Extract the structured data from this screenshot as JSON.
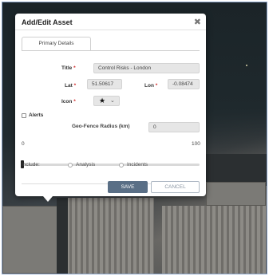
{
  "dialog": {
    "title": "Add/Edit Asset",
    "close_glyph": "✖",
    "tabs": [
      {
        "label": "Primary Details",
        "active": true
      }
    ],
    "form": {
      "title_label": "Title",
      "title_value": "Control Risks - London",
      "lat_label": "Lat",
      "lat_value": "51.50617",
      "lon_label": "Lon",
      "lon_value": "-0.08474",
      "icon_label": "Icon",
      "icon_value": "star-icon",
      "required_mark": "*",
      "alerts_label": "Alerts",
      "alerts_checked": false,
      "geofence_label": "Geo-Fence Radius (km)",
      "geofence_value": "0",
      "slider_min": "0",
      "slider_max": "100",
      "slider_value": 0,
      "include_label": "Include:",
      "include_options": [
        {
          "label": "Analysis",
          "selected": false
        },
        {
          "label": "Incidents",
          "selected": false
        }
      ]
    },
    "buttons": {
      "save": "SAVE",
      "cancel": "CANCEL"
    }
  },
  "colors": {
    "save_button": "#5a6f86",
    "required": "#d12a2a",
    "field_bg": "#e6e6e6"
  }
}
